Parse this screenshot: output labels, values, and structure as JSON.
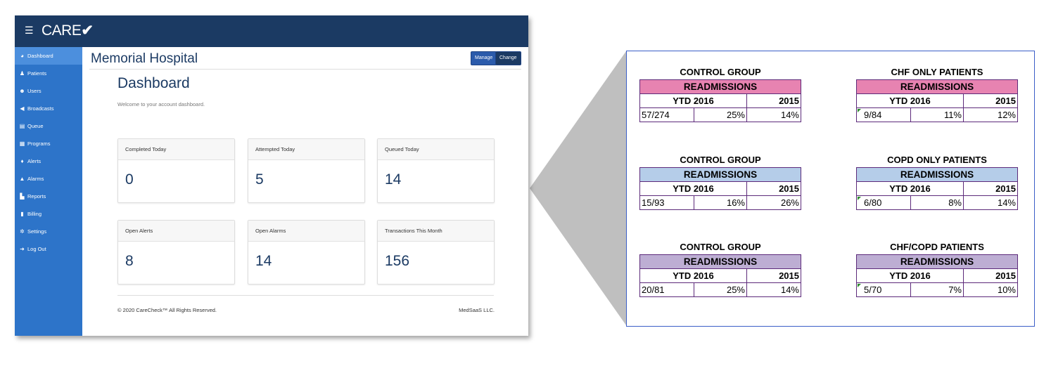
{
  "app": {
    "logo_text": "CARE",
    "logo_mark": "✔",
    "menu_icon": "hamburger-icon",
    "sidebar": [
      {
        "label": "Dashboard",
        "icon": "gauge-icon",
        "active": true
      },
      {
        "label": "Patients",
        "icon": "user-icon"
      },
      {
        "label": "Users",
        "icon": "users-icon"
      },
      {
        "label": "Broadcasts",
        "icon": "megaphone-icon"
      },
      {
        "label": "Queue",
        "icon": "clipboard-icon"
      },
      {
        "label": "Programs",
        "icon": "file-icon"
      },
      {
        "label": "Alerts",
        "icon": "bell-icon"
      },
      {
        "label": "Alarms",
        "icon": "warning-icon"
      },
      {
        "label": "Reports",
        "icon": "chart-icon"
      },
      {
        "label": "Billing",
        "icon": "invoice-icon"
      },
      {
        "label": "Settings",
        "icon": "cogs-icon"
      },
      {
        "label": "Log Out",
        "icon": "logout-icon"
      }
    ],
    "header": {
      "title": "Memorial Hospital",
      "manage_label": "Manage",
      "change_label": "Change"
    },
    "dashboard": {
      "title": "Dashboard",
      "welcome": "Welcome to your account dashboard."
    },
    "cards": [
      {
        "label": "Completed Today",
        "value": "0"
      },
      {
        "label": "Attempted Today",
        "value": "5"
      },
      {
        "label": "Queued Today",
        "value": "14"
      },
      {
        "label": "Open Alerts",
        "value": "8"
      },
      {
        "label": "Open Alarms",
        "value": "14"
      },
      {
        "label": "Transactions This Month",
        "value": "156"
      }
    ],
    "footer": {
      "copyright": "© 2020 CareCheck™ All Rights Reserved.",
      "company": "MedSaaS LLC."
    }
  },
  "readmissions": {
    "section_label": "READMISSIONS",
    "ytd_label": "YTD 2016",
    "prior_label": "2015",
    "colors": {
      "pink": "#e783b1",
      "blue": "#b5cde9",
      "lavender": "#bdaed3",
      "border": "#5c2a7a",
      "panel_border": "#3b5ec7"
    },
    "groups": [
      {
        "title": "CONTROL GROUP",
        "fraction": "57/274",
        "ytd_pct": "25%",
        "prior_pct": "14%",
        "color": "pink"
      },
      {
        "title": "CHF ONLY  PATIENTS",
        "fraction": "9/84",
        "ytd_pct": "11%",
        "prior_pct": "12%",
        "color": "pink"
      },
      {
        "title": "CONTROL GROUP",
        "fraction": "15/93",
        "ytd_pct": "16%",
        "prior_pct": "26%",
        "color": "blue"
      },
      {
        "title": "COPD  ONLY  PATIENTS",
        "fraction": "6/80",
        "ytd_pct": "8%",
        "prior_pct": "14%",
        "color": "blue"
      },
      {
        "title": "CONTROL GROUP",
        "fraction": "20/81",
        "ytd_pct": "25%",
        "prior_pct": "14%",
        "color": "lavender"
      },
      {
        "title": "CHF/COPD  PATIENTS",
        "fraction": "5/70",
        "ytd_pct": "7%",
        "prior_pct": "10%",
        "color": "lavender"
      }
    ]
  }
}
